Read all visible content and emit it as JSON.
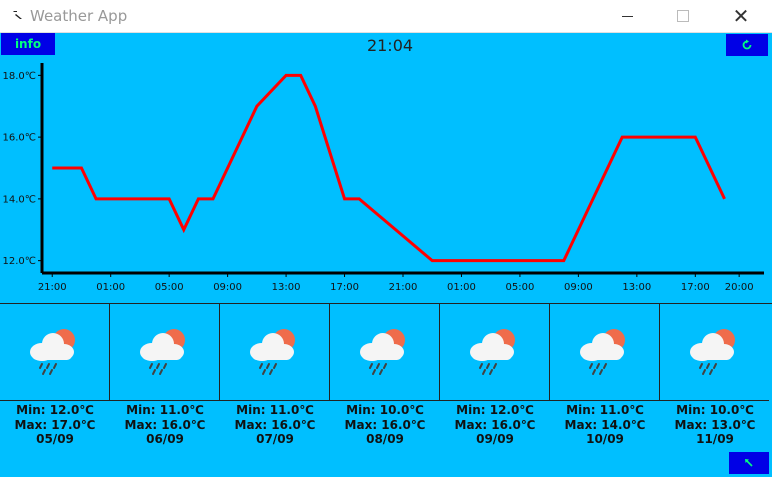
{
  "window": {
    "title": "Weather App"
  },
  "toolbar": {
    "info_label": "info",
    "time": "21:04"
  },
  "chart_data": {
    "type": "line",
    "title": "",
    "xlabel": "",
    "ylabel": "",
    "ylim": [
      11.6,
      18.4
    ],
    "y_ticks": [
      "12.0℃",
      "14.0℃",
      "16.0℃",
      "18.0℃"
    ],
    "y_tick_values": [
      12,
      14,
      16,
      18
    ],
    "x_ticks": [
      "21:00",
      "01:00",
      "05:00",
      "09:00",
      "13:00",
      "17:00",
      "21:00",
      "01:00",
      "05:00",
      "09:00",
      "13:00",
      "17:00",
      "20:00"
    ],
    "x_tick_hours": [
      0,
      4,
      8,
      12,
      16,
      20,
      24,
      28,
      32,
      36,
      40,
      44,
      47
    ],
    "xlim": [
      -0.7,
      48.7
    ],
    "series": [
      {
        "color": "#ff0000",
        "hours": [
          0,
          2,
          3,
          8,
          9,
          10,
          11,
          13,
          14,
          16,
          17,
          18,
          20,
          21,
          26,
          30,
          35,
          36,
          37,
          39,
          44,
          46
        ],
        "values": [
          15,
          15,
          14,
          14,
          13,
          14,
          14,
          16,
          17,
          18,
          18,
          17,
          14,
          14,
          12,
          12,
          12,
          13,
          14,
          16,
          16,
          14
        ]
      }
    ],
    "grid": false
  },
  "forecast": [
    {
      "min": "Min: 12.0℃",
      "max": "Max: 17.0℃",
      "date": "05/09",
      "icon": "rain-cloud-sun-icon"
    },
    {
      "min": "Min: 11.0℃",
      "max": "Max: 16.0℃",
      "date": "06/09",
      "icon": "rain-cloud-sun-icon"
    },
    {
      "min": "Min: 11.0℃",
      "max": "Max: 16.0℃",
      "date": "07/09",
      "icon": "rain-cloud-sun-icon"
    },
    {
      "min": "Min: 10.0℃",
      "max": "Max: 16.0℃",
      "date": "08/09",
      "icon": "rain-cloud-sun-icon"
    },
    {
      "min": "Min: 12.0℃",
      "max": "Max: 16.0℃",
      "date": "09/09",
      "icon": "rain-cloud-sun-icon"
    },
    {
      "min": "Min: 11.0℃",
      "max": "Max: 14.0℃",
      "date": "10/09",
      "icon": "rain-cloud-sun-icon"
    },
    {
      "min": "Min: 10.0℃",
      "max": "Max: 13.0℃",
      "date": "11/09",
      "icon": "rain-cloud-sun-icon"
    }
  ],
  "colors": {
    "background": "#00bfff",
    "button": "#0000e6",
    "accent_green": "#00ff7f",
    "line": "#ff0000"
  }
}
